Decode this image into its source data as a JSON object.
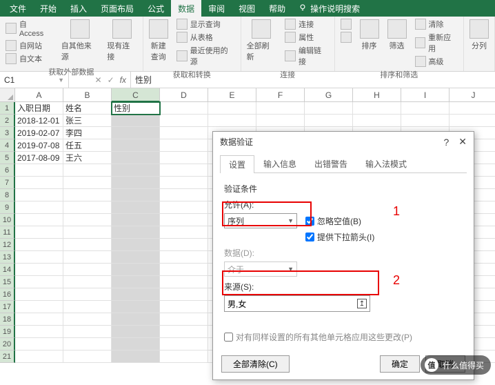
{
  "ribbon": {
    "tabs": [
      "文件",
      "开始",
      "插入",
      "页面布局",
      "公式",
      "数据",
      "审阅",
      "视图",
      "帮助"
    ],
    "active_tab": 5,
    "tell_me": "操作说明搜索",
    "groups": {
      "external": {
        "label": "获取外部数据",
        "access": "自 Access",
        "web": "自网站",
        "text": "自文本",
        "other": "自其他来源",
        "existing": "现有连接"
      },
      "transform": {
        "label": "获取和转换",
        "new_query": "新建\n查询",
        "show_query": "显示查询",
        "from_table": "从表格",
        "recent": "最近使用的源"
      },
      "connect": {
        "label": "连接",
        "refresh": "全部刷新",
        "conn": "连接",
        "prop": "属性",
        "edit": "编辑链接"
      },
      "sort": {
        "label": "排序和筛选",
        "az": "A→Z",
        "za": "Z→A",
        "sort": "排序",
        "filter": "筛选",
        "clear": "清除",
        "reapply": "重新应用",
        "adv": "高级"
      },
      "tools": {
        "split": "分列"
      }
    }
  },
  "formula_bar": {
    "name_box": "C1",
    "fx": "fx",
    "value": "性别"
  },
  "sheet": {
    "columns": [
      "A",
      "B",
      "C",
      "D",
      "E",
      "F",
      "G",
      "H",
      "I",
      "J"
    ],
    "selected_col": 2,
    "rows": [
      {
        "n": 1,
        "cells": [
          "入职日期",
          "姓名",
          "性别"
        ]
      },
      {
        "n": 2,
        "cells": [
          "2018-12-01",
          "张三",
          ""
        ]
      },
      {
        "n": 3,
        "cells": [
          "2019-02-07",
          "李四",
          ""
        ]
      },
      {
        "n": 4,
        "cells": [
          "2019-07-08",
          "任五",
          ""
        ]
      },
      {
        "n": 5,
        "cells": [
          "2017-08-09",
          "王六",
          ""
        ]
      },
      {
        "n": 6,
        "cells": [
          "",
          "",
          ""
        ]
      },
      {
        "n": 7,
        "cells": [
          "",
          "",
          ""
        ]
      },
      {
        "n": 8,
        "cells": [
          "",
          "",
          ""
        ]
      },
      {
        "n": 9,
        "cells": [
          "",
          "",
          ""
        ]
      },
      {
        "n": 10,
        "cells": [
          "",
          "",
          ""
        ]
      },
      {
        "n": 11,
        "cells": [
          "",
          "",
          ""
        ]
      },
      {
        "n": 12,
        "cells": [
          "",
          "",
          ""
        ]
      },
      {
        "n": 13,
        "cells": [
          "",
          "",
          ""
        ]
      },
      {
        "n": 14,
        "cells": [
          "",
          "",
          ""
        ]
      },
      {
        "n": 15,
        "cells": [
          "",
          "",
          ""
        ]
      },
      {
        "n": 16,
        "cells": [
          "",
          "",
          ""
        ]
      },
      {
        "n": 17,
        "cells": [
          "",
          "",
          ""
        ]
      },
      {
        "n": 18,
        "cells": [
          "",
          "",
          ""
        ]
      },
      {
        "n": 19,
        "cells": [
          "",
          "",
          ""
        ]
      },
      {
        "n": 20,
        "cells": [
          "",
          "",
          ""
        ]
      },
      {
        "n": 21,
        "cells": [
          "",
          "",
          ""
        ]
      }
    ]
  },
  "dialog": {
    "title": "数据验证",
    "tabs": [
      "设置",
      "输入信息",
      "出错警告",
      "输入法模式"
    ],
    "active_tab": 0,
    "criteria_label": "验证条件",
    "allow_label": "允许(A):",
    "allow_value": "序列",
    "ignore_blank": "忽略空值(B)",
    "dropdown": "提供下拉箭头(I)",
    "data_label": "数据(D):",
    "data_value": "介于",
    "source_label": "来源(S):",
    "source_value": "男,女",
    "apply_same": "对有同样设置的所有其他单元格应用这些更改(P)",
    "clear_all": "全部清除(C)",
    "ok": "确定",
    "cancel": "取消"
  },
  "annotations": {
    "one": "1",
    "two": "2"
  },
  "watermark": {
    "icon": "值",
    "text": "什么值得买"
  }
}
